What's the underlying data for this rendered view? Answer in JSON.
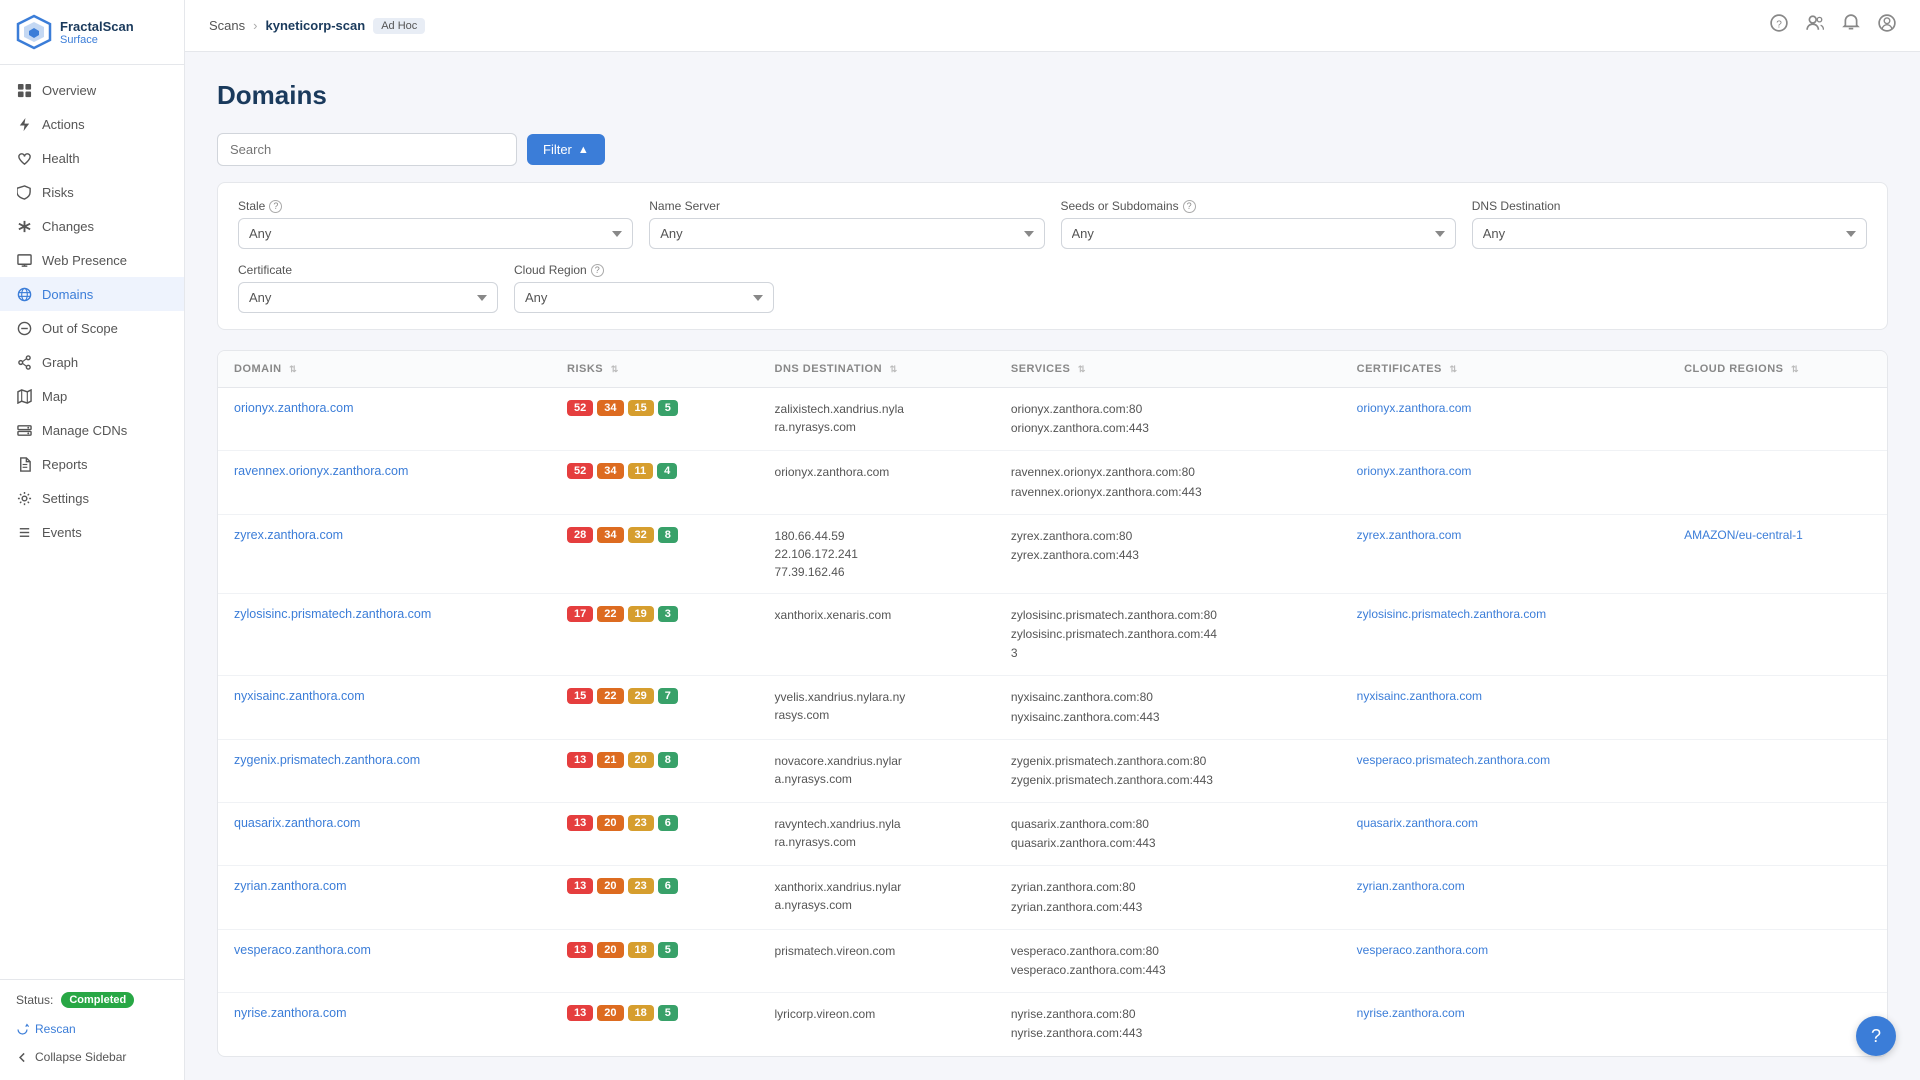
{
  "app": {
    "name": "FractalScan",
    "subtitle": "Surface"
  },
  "breadcrumb": {
    "scans": "Scans",
    "current": "kyneticorp-scan",
    "badge": "Ad Hoc"
  },
  "page": {
    "title": "Domains"
  },
  "search": {
    "placeholder": "Search"
  },
  "filter_button": "Filter",
  "filters": {
    "stale": {
      "label": "Stale",
      "value": "Any"
    },
    "name_server": {
      "label": "Name Server",
      "value": "Any"
    },
    "seeds_subdomains": {
      "label": "Seeds or Subdomains",
      "value": "Any"
    },
    "dns_destination": {
      "label": "DNS Destination",
      "value": "Any"
    },
    "certificate": {
      "label": "Certificate",
      "value": "Any"
    },
    "cloud_region": {
      "label": "Cloud Region",
      "value": "Any"
    }
  },
  "table": {
    "columns": [
      "DOMAIN",
      "RISKS",
      "DNS DESTINATION",
      "SERVICES",
      "CERTIFICATES",
      "CLOUD REGIONS"
    ],
    "rows": [
      {
        "domain": "orionyx.zanthora.com",
        "risks": [
          {
            "value": "52",
            "color": "red"
          },
          {
            "value": "34",
            "color": "orange"
          },
          {
            "value": "15",
            "color": "yellow"
          },
          {
            "value": "5",
            "color": "green"
          }
        ],
        "dns": "zalixistech.xandrius.nyla\nra.nyrasys.com",
        "services": "orionyx.zanthora.com:80\norionyx.zanthora.com:443",
        "certificates": "orionyx.zanthora.com",
        "cloud_regions": ""
      },
      {
        "domain": "ravennex.orionyx.zanthora.com",
        "risks": [
          {
            "value": "52",
            "color": "red"
          },
          {
            "value": "34",
            "color": "orange"
          },
          {
            "value": "11",
            "color": "yellow"
          },
          {
            "value": "4",
            "color": "green"
          }
        ],
        "dns": "orionyx.zanthora.com",
        "services": "ravennex.orionyx.zanthora.com:80\nravennex.orionyx.zanthora.com:443",
        "certificates": "orionyx.zanthora.com",
        "cloud_regions": ""
      },
      {
        "domain": "zyrex.zanthora.com",
        "risks": [
          {
            "value": "28",
            "color": "red"
          },
          {
            "value": "34",
            "color": "orange"
          },
          {
            "value": "32",
            "color": "yellow"
          },
          {
            "value": "8",
            "color": "green"
          }
        ],
        "dns": "180.66.44.59\n22.106.172.241\n77.39.162.46",
        "services": "zyrex.zanthora.com:80\nzyrex.zanthora.com:443",
        "certificates": "zyrex.zanthora.com",
        "cloud_regions": "AMAZON/eu-central-1"
      },
      {
        "domain": "zylosisinc.prismatech.zanthora.com",
        "risks": [
          {
            "value": "17",
            "color": "red"
          },
          {
            "value": "22",
            "color": "orange"
          },
          {
            "value": "19",
            "color": "yellow"
          },
          {
            "value": "3",
            "color": "green"
          }
        ],
        "dns": "xanthorix.xenaris.com",
        "services": "zylosisinc.prismatech.zanthora.com:80\nzylosisinc.prismatech.zanthora.com:44\n3",
        "certificates": "zylosisinc.prismatech.zanthora.com",
        "cloud_regions": ""
      },
      {
        "domain": "nyxisainc.zanthora.com",
        "risks": [
          {
            "value": "15",
            "color": "red"
          },
          {
            "value": "22",
            "color": "orange"
          },
          {
            "value": "29",
            "color": "yellow"
          },
          {
            "value": "7",
            "color": "green"
          }
        ],
        "dns": "yvelis.xandrius.nylara.ny\nrasys.com",
        "services": "nyxisainc.zanthora.com:80\nnyxisainc.zanthora.com:443",
        "certificates": "nyxisainc.zanthora.com",
        "cloud_regions": ""
      },
      {
        "domain": "zygenix.prismatech.zanthora.com",
        "risks": [
          {
            "value": "13",
            "color": "red"
          },
          {
            "value": "21",
            "color": "orange"
          },
          {
            "value": "20",
            "color": "yellow"
          },
          {
            "value": "8",
            "color": "green"
          }
        ],
        "dns": "novacore.xandrius.nylar\na.nyrasys.com",
        "services": "zygenix.prismatech.zanthora.com:80\nzygenix.prismatech.zanthora.com:443",
        "certificates": "vesperaco.prismatech.zanthora.com",
        "cloud_regions": ""
      },
      {
        "domain": "quasarix.zanthora.com",
        "risks": [
          {
            "value": "13",
            "color": "red"
          },
          {
            "value": "20",
            "color": "orange"
          },
          {
            "value": "23",
            "color": "yellow"
          },
          {
            "value": "6",
            "color": "green"
          }
        ],
        "dns": "ravyntech.xandrius.nyla\nra.nyrasys.com",
        "services": "quasarix.zanthora.com:80\nquasarix.zanthora.com:443",
        "certificates": "quasarix.zanthora.com",
        "cloud_regions": ""
      },
      {
        "domain": "zyrian.zanthora.com",
        "risks": [
          {
            "value": "13",
            "color": "red"
          },
          {
            "value": "20",
            "color": "orange"
          },
          {
            "value": "23",
            "color": "yellow"
          },
          {
            "value": "6",
            "color": "green"
          }
        ],
        "dns": "xanthorix.xandrius.nylar\na.nyrasys.com",
        "services": "zyrian.zanthora.com:80\nzyrian.zanthora.com:443",
        "certificates": "zyrian.zanthora.com",
        "cloud_regions": ""
      },
      {
        "domain": "vesperaco.zanthora.com",
        "risks": [
          {
            "value": "13",
            "color": "red"
          },
          {
            "value": "20",
            "color": "orange"
          },
          {
            "value": "18",
            "color": "yellow"
          },
          {
            "value": "5",
            "color": "green"
          }
        ],
        "dns": "prismatech.vireon.com",
        "services": "vesperaco.zanthora.com:80\nvesperaco.zanthora.com:443",
        "certificates": "vesperaco.zanthora.com",
        "cloud_regions": ""
      },
      {
        "domain": "nyrise.zanthora.com",
        "risks": [
          {
            "value": "13",
            "color": "red"
          },
          {
            "value": "20",
            "color": "orange"
          },
          {
            "value": "18",
            "color": "yellow"
          },
          {
            "value": "5",
            "color": "green"
          }
        ],
        "dns": "lyricorp.vireon.com",
        "services": "nyrise.zanthora.com:80\nnyrise.zanthora.com:443",
        "certificates": "nyrise.zanthora.com",
        "cloud_regions": ""
      }
    ]
  },
  "nav": {
    "items": [
      {
        "id": "overview",
        "label": "Overview",
        "icon": "grid"
      },
      {
        "id": "actions",
        "label": "Actions",
        "icon": "lightning"
      },
      {
        "id": "health",
        "label": "Health",
        "icon": "heart"
      },
      {
        "id": "risks",
        "label": "Risks",
        "icon": "shield"
      },
      {
        "id": "changes",
        "label": "Changes",
        "icon": "asterisk"
      },
      {
        "id": "web-presence",
        "label": "Web Presence",
        "icon": "monitor"
      },
      {
        "id": "domains",
        "label": "Domains",
        "icon": "globe"
      },
      {
        "id": "out-of-scope",
        "label": "Out of Scope",
        "icon": "minus-circle"
      },
      {
        "id": "graph",
        "label": "Graph",
        "icon": "share"
      },
      {
        "id": "map",
        "label": "Map",
        "icon": "map"
      },
      {
        "id": "manage-cdns",
        "label": "Manage CDNs",
        "icon": "server"
      },
      {
        "id": "reports",
        "label": "Reports",
        "icon": "file"
      },
      {
        "id": "settings",
        "label": "Settings",
        "icon": "gear"
      },
      {
        "id": "events",
        "label": "Events",
        "icon": "list"
      }
    ]
  },
  "status": {
    "label": "Status:",
    "value": "Completed"
  },
  "actions": {
    "rescan": "Rescan",
    "collapse": "Collapse Sidebar"
  }
}
